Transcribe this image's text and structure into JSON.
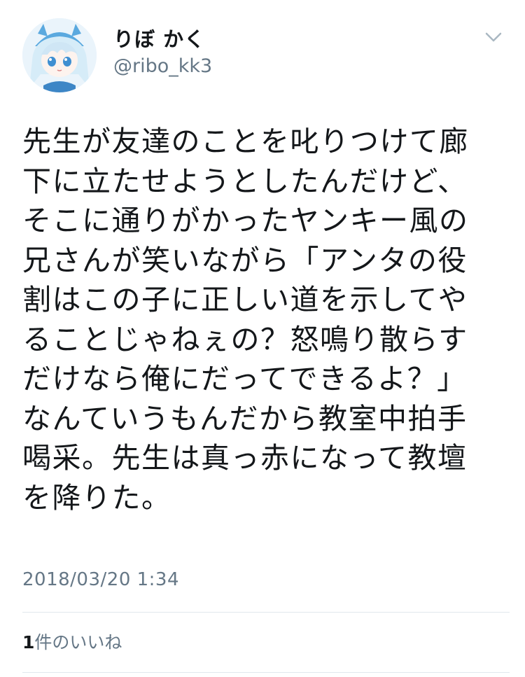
{
  "tweet": {
    "display_name": "りぼ かく",
    "handle": "@ribo_kk3",
    "body_lines": [
      "先生が友達のことを叱りつけて廊",
      "下に立たせようとしたんだけど、",
      "そこに通りがかったヤンキー風の",
      "兄さんが笑いながら「アンタの役",
      "割はこの子に正しい道を示してや",
      "ることじゃねぇの？怒鳴り散らす",
      "だけなら俺にだってできるよ？」",
      "なんていうもんだから教室中拍手",
      "喝采。先生は真っ赤になって教壇",
      "を降りた。"
    ],
    "timestamp": "2018/03/20 1:34",
    "likes": {
      "count": "1",
      "label": "件のいいね"
    }
  },
  "icons": {
    "avatar": "anime-avatar",
    "menu": "chevron-down-icon"
  }
}
